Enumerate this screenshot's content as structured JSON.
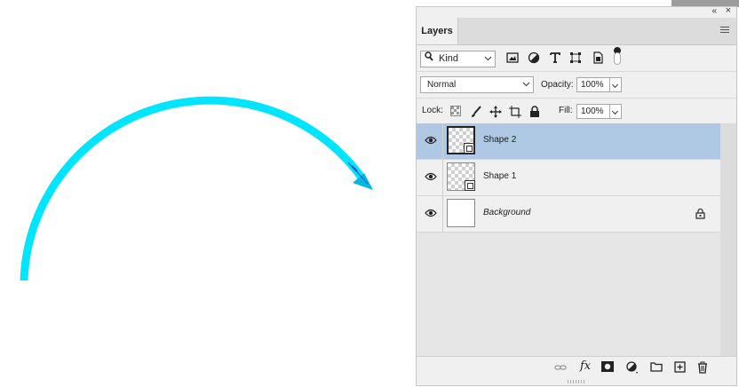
{
  "canvas": {
    "shape_color": "#00e5ff",
    "arrowhead_color": "#00b8e0",
    "path_outline_color": "#2050c8"
  },
  "panel": {
    "collapse_glyph": "«",
    "close_glyph": "×",
    "tab_label": "Layers",
    "filter": {
      "icon": "search-icon",
      "kind_label": "Kind"
    },
    "filter_icons": [
      "image-filter-icon",
      "adjustment-filter-icon",
      "type-filter-icon",
      "shape-filter-icon",
      "smart-object-filter-icon"
    ],
    "blend_mode": "Normal",
    "opacity_label": "Opacity:",
    "opacity_value": "100%",
    "lock_label": "Lock:",
    "fill_label": "Fill:",
    "fill_value": "100%",
    "layers": [
      {
        "name": "Shape 2",
        "selected": true,
        "visible": true,
        "italic": false,
        "locked": false
      },
      {
        "name": "Shape 1",
        "selected": false,
        "visible": true,
        "italic": false,
        "locked": false
      },
      {
        "name": "Background",
        "selected": false,
        "visible": true,
        "italic": true,
        "locked": true
      }
    ],
    "footer_buttons": [
      "link-icon",
      "fx-icon",
      "mask-icon",
      "adjustment-icon",
      "folder-icon",
      "new-layer-icon",
      "trash-icon"
    ],
    "fx_label": "fx",
    "selection_color": "#afc8e3"
  }
}
